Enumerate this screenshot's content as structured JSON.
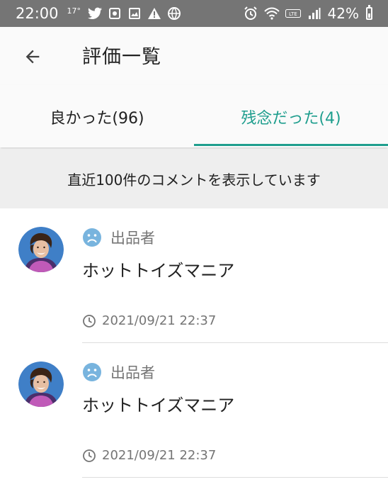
{
  "status_bar": {
    "time": "22:00",
    "temp": "17°",
    "battery": "42%",
    "icons_left": [
      "twitter-icon",
      "app-icon",
      "image-icon",
      "warning-icon",
      "globe-icon"
    ],
    "icons_right": [
      "alarm-icon",
      "wifi-icon",
      "volte-icon",
      "signal-icon",
      "battery-icon"
    ]
  },
  "app_bar": {
    "title": "評価一覧",
    "back_icon": "arrow-back-icon"
  },
  "tabs": [
    {
      "label": "良かった(96)",
      "active": false
    },
    {
      "label": "残念だった(4)",
      "active": true
    }
  ],
  "accent_color": "#1f9e8e",
  "notice": "直近100件のコメントを表示しています",
  "reviews": [
    {
      "role": "出品者",
      "name": "ホットトイズマニア",
      "datetime": "2021/09/21 22:37",
      "rating_icon": "sad-face-icon"
    },
    {
      "role": "出品者",
      "name": "ホットトイズマニア",
      "datetime": "2021/09/21 22:37",
      "rating_icon": "sad-face-icon"
    }
  ]
}
